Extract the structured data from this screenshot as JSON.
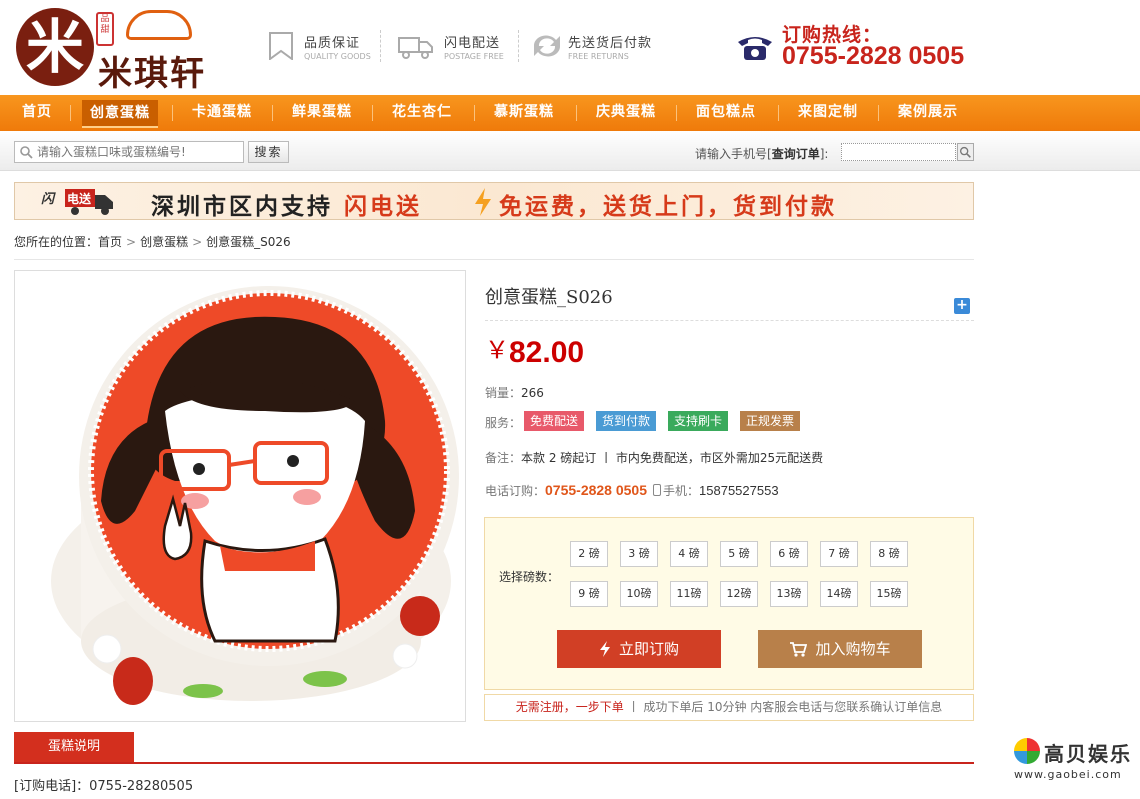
{
  "header": {
    "logo_text": "米琪轩",
    "logo_mark": "米",
    "logo_seal": "品甜",
    "features": [
      {
        "title": "品质保证",
        "sub": "QUALITY GOODS",
        "icon": "bookmark-icon"
      },
      {
        "title": "闪电配送",
        "sub": "POSTAGE FREE",
        "icon": "truck-icon"
      },
      {
        "title": "先送货后付款",
        "sub": "FREE RETURNS",
        "icon": "return-icon"
      }
    ],
    "hotline_label": "订购热线：",
    "hotline_number": "0755-2828 0505"
  },
  "nav": {
    "items": [
      {
        "label": "首页"
      },
      {
        "label": "创意蛋糕"
      },
      {
        "label": "卡通蛋糕"
      },
      {
        "label": "鲜果蛋糕"
      },
      {
        "label": "花生杏仁"
      },
      {
        "label": "慕斯蛋糕"
      },
      {
        "label": "庆典蛋糕"
      },
      {
        "label": "面包糕点"
      },
      {
        "label": "来图定制"
      },
      {
        "label": "案例展示"
      }
    ],
    "active_index": 1
  },
  "search": {
    "placeholder": "请输入蛋糕口味或蛋糕编号!",
    "button": "搜索",
    "order_prefix": "请输入手机号[",
    "order_query": "查询订单",
    "order_suffix": "]:"
  },
  "banner": {
    "badge": "闪电送",
    "text_a": "深圳市区内支持",
    "text_b": "闪电送",
    "text_c": "免运费，送货上门，货到付款"
  },
  "breadcrumb": {
    "prefix": "您所在的位置：",
    "items": [
      "首页",
      "创意蛋糕",
      "创意蛋糕_S026"
    ]
  },
  "product": {
    "title": "创意蛋糕_S026",
    "currency": "￥",
    "price": "82.00",
    "sales_label": "销量：",
    "sales": "266",
    "service_label": "服务：",
    "services": [
      {
        "label": "免费配送",
        "color": "#e8596a"
      },
      {
        "label": "货到付款",
        "color": "#4a9bd4"
      },
      {
        "label": "支持刷卡",
        "color": "#3aaa5c"
      },
      {
        "label": "正规发票",
        "color": "#b8804a"
      }
    ],
    "note_label": "备注：",
    "note": "本款 2 磅起订 丨 市内免费配送，市区外需加25元配送费",
    "tel_label": "电话订购：",
    "tel": "0755-2828 0505",
    "mobile_label": "手机：",
    "mobile": "15875527553",
    "weight_label": "选择磅数：",
    "weights": [
      "2 磅",
      "3 磅",
      "4 磅",
      "5 磅",
      "6 磅",
      "7 磅",
      "8 磅",
      "9 磅",
      "10磅",
      "11磅",
      "12磅",
      "13磅",
      "14磅",
      "15磅"
    ],
    "buy_label": "立即订购",
    "cart_label": "加入购物车",
    "notice_red": "无需注册，一步下单",
    "notice_rest": "丨 成功下单后 10分钟 内客服会电话与您联系确认订单信息"
  },
  "tabs": {
    "active": "蛋糕说明"
  },
  "description": "[订购电话]：0755-28280505",
  "watermark": {
    "text": "高贝娱乐",
    "url": "www.gaobei.com"
  }
}
